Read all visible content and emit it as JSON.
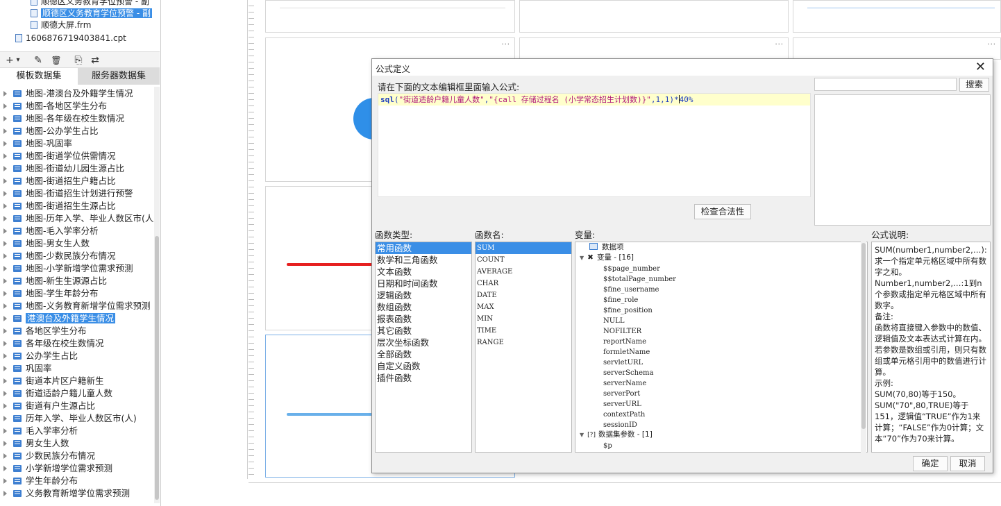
{
  "file_tree": {
    "items": [
      {
        "label": "顺德区义务教育学位预警 - 副",
        "selected": false
      },
      {
        "label": "顺德区义务教育学位预警 - 副",
        "selected": true
      },
      {
        "label": "顺德大屏.frm",
        "selected": false
      },
      {
        "label": "1606876719403841.cpt",
        "selected": false
      }
    ]
  },
  "toolbar": {
    "add": "+",
    "add_dropdown": "▾",
    "edit": "✎",
    "delete": "🗑",
    "preview": "⎘",
    "swap": "⇄"
  },
  "tabs": [
    {
      "label": "模板数据集",
      "active": true
    },
    {
      "label": "服务器数据集",
      "active": false
    }
  ],
  "datasets": [
    {
      "label": "地图-港澳台及外籍学生情况",
      "selected": false
    },
    {
      "label": "地图-各地区学生分布",
      "selected": false
    },
    {
      "label": "地图-各年级在校生数情况",
      "selected": false
    },
    {
      "label": "地图-公办学生占比",
      "selected": false
    },
    {
      "label": "地图-巩固率",
      "selected": false
    },
    {
      "label": "地图-街道学位供需情况",
      "selected": false
    },
    {
      "label": "地图-街道幼儿园生源占比",
      "selected": false
    },
    {
      "label": "地图-街道招生户籍占比",
      "selected": false
    },
    {
      "label": "地图-街道招生计划进行预警",
      "selected": false
    },
    {
      "label": "地图-街道招生生源占比",
      "selected": false
    },
    {
      "label": "地图-历年入学、毕业人数区市(人",
      "selected": false
    },
    {
      "label": "地图-毛入学率分析",
      "selected": false
    },
    {
      "label": "地图-男女生人数",
      "selected": false
    },
    {
      "label": "地图-少数民族分布情况",
      "selected": false
    },
    {
      "label": "地图-小学新增学位需求预测",
      "selected": false
    },
    {
      "label": "地图-新生生源源占比",
      "selected": false
    },
    {
      "label": "地图-学生年龄分布",
      "selected": false
    },
    {
      "label": "地图-义务教育新增学位需求预测",
      "selected": false
    },
    {
      "label": "港澳台及外籍学生情况",
      "selected": true
    },
    {
      "label": "各地区学生分布",
      "selected": false
    },
    {
      "label": "各年级在校生数情况",
      "selected": false
    },
    {
      "label": "公办学生占比",
      "selected": false
    },
    {
      "label": "巩固率",
      "selected": false
    },
    {
      "label": "街道本片区户籍新生",
      "selected": false
    },
    {
      "label": "街道适龄户籍儿童人数",
      "selected": false
    },
    {
      "label": "街道有户生源占比",
      "selected": false
    },
    {
      "label": "历年入学、毕业人数区市(人)",
      "selected": false
    },
    {
      "label": "毛入学率分析",
      "selected": false
    },
    {
      "label": "男女生人数",
      "selected": false
    },
    {
      "label": "少数民族分布情况",
      "selected": false
    },
    {
      "label": "小学新增学位需求预测",
      "selected": false
    },
    {
      "label": "学生年龄分布",
      "selected": false
    },
    {
      "label": "义务教育新增学位需求预测",
      "selected": false
    }
  ],
  "canvas": {
    "panel_menu": "···"
  },
  "dialog": {
    "title": "公式定义",
    "close": "✕",
    "prompt": "请在下面的文本编辑框里面输入公式:",
    "formula": {
      "fn": "sql",
      "open": "(",
      "arg1": "\"街道适龄户籍儿童人数\"",
      "comma1": ",",
      "arg2": "\"{call  存储过程名  (小学常态招生计划数)}\"",
      "rest_before_caret": ",1,1)*",
      "rest_after_caret": "40%"
    },
    "check_button": "检查合法性",
    "search_button": "搜索",
    "search_placeholder": "",
    "category_label": "函数类型:",
    "categories": [
      {
        "label": "常用函数",
        "selected": true
      },
      {
        "label": "数学和三角函数",
        "selected": false
      },
      {
        "label": "文本函数",
        "selected": false
      },
      {
        "label": "日期和时间函数",
        "selected": false
      },
      {
        "label": "逻辑函数",
        "selected": false
      },
      {
        "label": "数组函数",
        "selected": false
      },
      {
        "label": "报表函数",
        "selected": false
      },
      {
        "label": "其它函数",
        "selected": false
      },
      {
        "label": "层次坐标函数",
        "selected": false
      },
      {
        "label": "全部函数",
        "selected": false
      },
      {
        "label": "自定义函数",
        "selected": false
      },
      {
        "label": "插件函数",
        "selected": false
      }
    ],
    "fn_name_label": "函数名:",
    "functions": [
      {
        "label": "SUM",
        "selected": true
      },
      {
        "label": "COUNT",
        "selected": false
      },
      {
        "label": "AVERAGE",
        "selected": false
      },
      {
        "label": "CHAR",
        "selected": false
      },
      {
        "label": "DATE",
        "selected": false
      },
      {
        "label": "MAX",
        "selected": false
      },
      {
        "label": "MIN",
        "selected": false
      },
      {
        "label": "TIME",
        "selected": false
      },
      {
        "label": "RANGE",
        "selected": false
      }
    ],
    "var_label": "变量:",
    "variables": {
      "data_item": "数据项",
      "var_group": "变量 - [16]",
      "vars": [
        "$$page_number",
        "$$totalPage_number",
        "$fine_username",
        "$fine_role",
        "$fine_position",
        "NULL",
        "NOFILTER",
        "reportName",
        "formletName",
        "servletURL",
        "serverSchema",
        "serverName",
        "serverPort",
        "serverURL",
        "contextPath",
        "sessionID"
      ],
      "param_group": "数据集参数 - [1]",
      "params": [
        "$p"
      ]
    },
    "desc_label": "公式说明:",
    "desc_lines": [
      "SUM(number1,number2,…):求一个指定单元格区域中所有数字之和。",
      "Number1,number2,…:1到n个参数或指定单元格区域中所有数字。",
      "备注:",
      "函数将直接键入参数中的数值、逻辑值及文本表达式计算在内。若参数是数组或引用，则只有数组或单元格引用中的数值进行计算。",
      "示例:",
      "SUM(70,80)等于150。",
      "SUM(\"70\",80,TRUE)等于151，逻辑值“TRUE”作为1来计算；“FALSE”作为0计算；文本“70”作为70来计算。"
    ],
    "ok_button": "确定",
    "cancel_button": "取消"
  }
}
